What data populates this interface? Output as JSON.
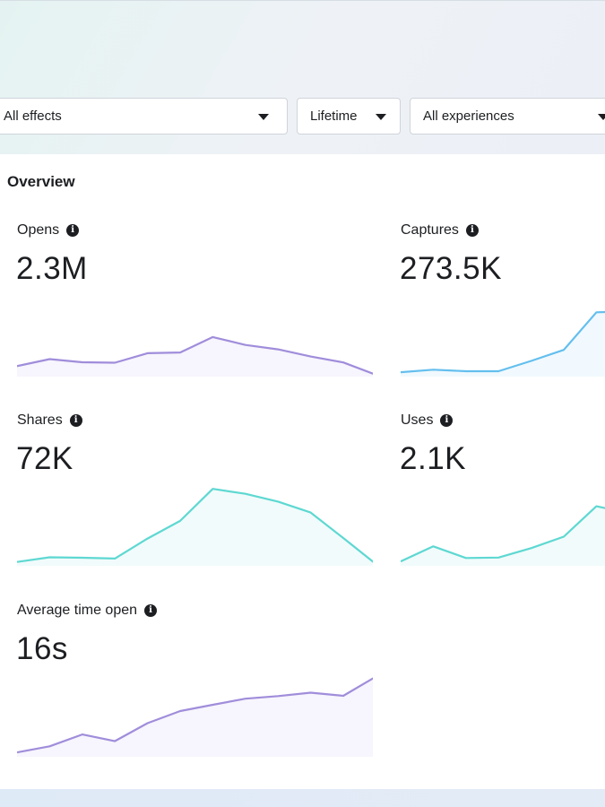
{
  "filters": {
    "effects": "All effects",
    "time_range": "Lifetime",
    "experiences": "All experiences"
  },
  "overview": {
    "title": "Overview"
  },
  "colors": {
    "purple": "#a08ddb",
    "purple_fill": "#f7f5fd",
    "blue": "#64bfee",
    "blue_fill": "#f1f9fe",
    "teal": "#5ed8d2",
    "teal_fill": "#f1fbfb"
  },
  "metrics": {
    "opens": {
      "label": "Opens",
      "value": "2.3M"
    },
    "captures": {
      "label": "Captures",
      "value": "273.5K"
    },
    "shares": {
      "label": "Shares",
      "value": "72K"
    },
    "uses": {
      "label": "Uses",
      "value": "2.1K"
    },
    "avg_time": {
      "label": "Average time open",
      "value": "16s"
    }
  },
  "chart_data": [
    {
      "type": "area",
      "series": [
        {
          "values": [
            0.34,
            0.61,
            0.49,
            0.47,
            0.84,
            0.87,
            1.47,
            1.16,
            0.99,
            0.71,
            0.48,
            0.0
          ]
        }
      ]
    },
    {
      "type": "area",
      "series": [
        {
          "values": [
            0.1,
            0.2,
            0.14,
            0.14,
            0.54,
            0.97,
            2.43,
            2.47
          ]
        }
      ]
    },
    {
      "type": "area",
      "series": [
        {
          "values": [
            0.08,
            0.26,
            0.24,
            0.21,
            0.98,
            1.66,
            2.89,
            2.7,
            2.4,
            1.98,
            1.0,
            0.0
          ]
        }
      ]
    },
    {
      "type": "area",
      "series": [
        {
          "values": [
            0.1,
            0.68,
            0.23,
            0.25,
            0.61,
            1.05,
            2.22,
            1.96
          ]
        }
      ]
    },
    {
      "type": "area",
      "series": [
        {
          "values": [
            0.1,
            0.33,
            0.78,
            0.53,
            1.21,
            1.67,
            1.91,
            2.14,
            2.24,
            2.37,
            2.25,
            2.98
          ]
        }
      ]
    }
  ]
}
